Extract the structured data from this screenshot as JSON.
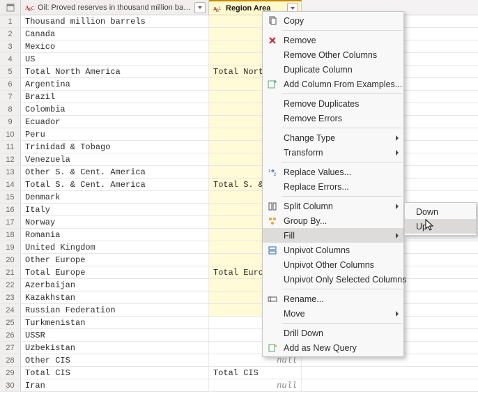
{
  "columns": {
    "col1": {
      "label": "Oil: Proved reserves in thousand million barrels"
    },
    "col2": {
      "label": "Region Area"
    }
  },
  "rows": [
    {
      "n": "1",
      "c1": "Thousand million barrels",
      "c2": ""
    },
    {
      "n": "2",
      "c1": "Canada",
      "c2": ""
    },
    {
      "n": "3",
      "c1": "Mexico",
      "c2": ""
    },
    {
      "n": "4",
      "c1": "US",
      "c2": ""
    },
    {
      "n": "5",
      "c1": "Total North America",
      "c2": "Total North"
    },
    {
      "n": "6",
      "c1": "Argentina",
      "c2": ""
    },
    {
      "n": "7",
      "c1": "Brazil",
      "c2": ""
    },
    {
      "n": "8",
      "c1": "Colombia",
      "c2": ""
    },
    {
      "n": "9",
      "c1": "Ecuador",
      "c2": ""
    },
    {
      "n": "10",
      "c1": "Peru",
      "c2": ""
    },
    {
      "n": "11",
      "c1": "Trinidad & Tobago",
      "c2": ""
    },
    {
      "n": "12",
      "c1": "Venezuela",
      "c2": ""
    },
    {
      "n": "13",
      "c1": "Other S. & Cent. America",
      "c2": ""
    },
    {
      "n": "14",
      "c1": "Total S. & Cent. America",
      "c2": "Total S. & C"
    },
    {
      "n": "15",
      "c1": "Denmark",
      "c2": ""
    },
    {
      "n": "16",
      "c1": "Italy",
      "c2": ""
    },
    {
      "n": "17",
      "c1": "Norway",
      "c2": ""
    },
    {
      "n": "18",
      "c1": "Romania",
      "c2": ""
    },
    {
      "n": "19",
      "c1": "United Kingdom",
      "c2": ""
    },
    {
      "n": "20",
      "c1": "Other Europe",
      "c2": ""
    },
    {
      "n": "21",
      "c1": "Total Europe",
      "c2": "Total Europe"
    },
    {
      "n": "22",
      "c1": "Azerbaijan",
      "c2": ""
    },
    {
      "n": "23",
      "c1": "Kazakhstan",
      "c2": ""
    },
    {
      "n": "24",
      "c1": "Russian Federation",
      "c2": ""
    },
    {
      "n": "25",
      "c1": "Turkmenistan",
      "c2": "null",
      "null": true
    },
    {
      "n": "26",
      "c1": "USSR",
      "c2": "null",
      "null": true
    },
    {
      "n": "27",
      "c1": "Uzbekistan",
      "c2": "null",
      "null": true
    },
    {
      "n": "28",
      "c1": "Other CIS",
      "c2": "null",
      "null": true
    },
    {
      "n": "29",
      "c1": "Total CIS",
      "c2": "Total CIS"
    },
    {
      "n": "30",
      "c1": "Iran",
      "c2": "null",
      "null": true
    }
  ],
  "menu": {
    "copy": "Copy",
    "remove": "Remove",
    "remove_other": "Remove Other Columns",
    "duplicate": "Duplicate Column",
    "add_from_examples": "Add Column From Examples...",
    "remove_dupes": "Remove Duplicates",
    "remove_errors": "Remove Errors",
    "change_type": "Change Type",
    "transform": "Transform",
    "replace_values": "Replace Values...",
    "replace_errors": "Replace Errors...",
    "split_column": "Split Column",
    "group_by": "Group By...",
    "fill": "Fill",
    "unpivot": "Unpivot Columns",
    "unpivot_other": "Unpivot Other Columns",
    "unpivot_selected": "Unpivot Only Selected Columns",
    "rename": "Rename...",
    "move": "Move",
    "drill_down": "Drill Down",
    "add_as_query": "Add as New Query"
  },
  "submenu": {
    "down": "Down",
    "up": "Up"
  }
}
